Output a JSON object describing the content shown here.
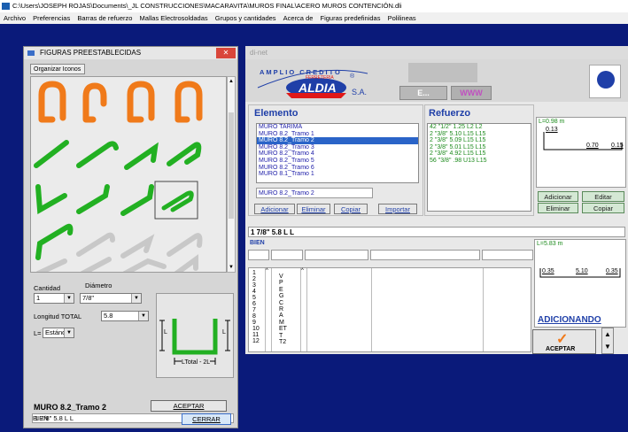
{
  "window": {
    "title": "C:\\Users\\JOSEPH ROJAS\\Documents\\_JL CONSTRUCCIONES\\MACARAVITA\\MUROS FINAL\\ACERO MUROS CONTENCIÓN.dli"
  },
  "menu": [
    "Archivo",
    "Preferencias",
    "Barras de refuerzo",
    "Mallas Electrosoldadas",
    "Grupos y cantidades",
    "Acerca de",
    "Figuras predefinidas",
    "Polilineas"
  ],
  "figuras": {
    "title": "FIGURAS PREESTABLECIDAS",
    "tab": "Organizar Iconos",
    "cantidad_label": "Cantidad",
    "cantidad_value": "1",
    "diametro_label": "Diámetro",
    "diametro_value": "7/8\"",
    "longitud_label": "Longitud TOTAL",
    "longitud_value": "5.8",
    "l_label": "L=",
    "l_value": "Estánda",
    "diagram_label": "LTotal - 2L",
    "diagram_side_left": "L",
    "diagram_side_right": "L",
    "item_name": "MURO 8.2_Tramo 2",
    "aceptar": "ACEPTAR",
    "result_text": "1 7/8\" 5.8 L L",
    "status": "BIEN",
    "cerrar": "CERRAR"
  },
  "dinet": {
    "title": "di-net",
    "banner": {
      "brand_top": "AMPLIO CREDITO",
      "brand_sub": "FERRETERIA",
      "brand_main": "ALDIA",
      "brand_sa": "S.A.",
      "btn1": "E...",
      "btn2": "WWW",
      "reg": "®"
    },
    "elemento": {
      "header": "Elemento",
      "items": [
        "MURO TARIMA",
        "MURO 8.2_Tramo 1",
        "MURO 8.2_Tramo 2",
        "MURO 8.2_Tramo 3",
        "MURO 8.2_Tramo 4",
        "MURO 8.2_Tramo 5",
        "MURO 8.2_Tramo 6",
        "MURO 8.1_Tramo 1"
      ],
      "selected_index": 2,
      "input": "MURO 8.2_Tramo 2",
      "buttons": [
        "Adicionar",
        "Eliminar",
        "Copiar",
        "Importar"
      ]
    },
    "refuerzo": {
      "header": "Refuerzo",
      "items": [
        "42  \"1/2\"  1.25  L2  L2",
        "2  \"3/8\"  5.10  L15  L15",
        "2  \"3/8\"  5.09  L15  L15",
        "2  \"3/8\"  5.01  L15  L15",
        "2  \"3/8\"  4.92  L15  L15",
        "56  \"3/8\"  .98  U13  L15"
      ]
    },
    "preview": {
      "l_text": "L=0.98 m",
      "v1": "0.13",
      "v2": "0.70",
      "v3": "0.15",
      "buttons": [
        "Adicionar",
        "Editar",
        "Eliminar",
        "Copiar"
      ]
    },
    "entry": {
      "value": "1 7/8\" 5.8 L L",
      "status": "BIEN"
    },
    "rows": [
      "1",
      "2",
      "3",
      "4",
      "5",
      "6",
      "7",
      "8",
      "9",
      "10",
      "11",
      "12"
    ],
    "codes": [
      "V",
      "P",
      "E",
      "G",
      "C",
      "R",
      "A",
      "M",
      "ET",
      "T",
      "T2"
    ],
    "preview2": {
      "l_text": "L=5.83 m",
      "v1": "0.35",
      "v2": "5.10",
      "v3": "0.35"
    },
    "adicionando": "ADICIONANDO",
    "aceptar": "ACEPTAR"
  },
  "colors": {
    "mdi_bg": "#0a1a7a",
    "accent_blue": "#1f3fa8",
    "selection": "#2a64c8",
    "figure_orange": "#f07a1a",
    "figure_green": "#22b022"
  }
}
